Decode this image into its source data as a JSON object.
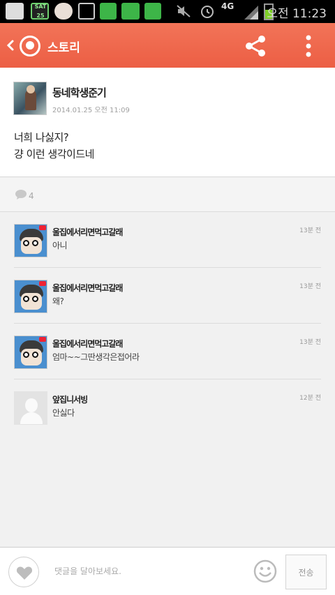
{
  "status_bar": {
    "time": "오전 11:23",
    "network": "4G",
    "calendar_date": "SAT 25",
    "notification_icons": [
      "add-icon",
      "calendar-icon",
      "bear-icon",
      "image-icon",
      "naver-icon",
      "blog-icon",
      "naver-icon",
      "mute-icon",
      "alarm-icon"
    ]
  },
  "app_bar": {
    "title": "스토리",
    "accent_color": "#ef6a50"
  },
  "post": {
    "author": "동네학생준기",
    "date": "2014.01.25 오전 11:09",
    "body_lines": [
      "너희 나싫지?",
      "걍 이런 생각이드네"
    ]
  },
  "comment_count": "4",
  "comments": [
    {
      "name": "울집에서리면먹고갈래",
      "text": "아니",
      "time": "13분 전",
      "avatar": "cartoon"
    },
    {
      "name": "울집에서리면먹고갈래",
      "text": "왜?",
      "time": "13분 전",
      "avatar": "cartoon"
    },
    {
      "name": "울집에서리면먹고갈래",
      "text": "엄마~~그딴생각은접어라",
      "time": "13분 전",
      "avatar": "cartoon"
    },
    {
      "name": "앞집니서빙",
      "text": "안싫다",
      "time": "12분 전",
      "avatar": "default"
    }
  ],
  "input_bar": {
    "placeholder": "댓글을 달아보세요.",
    "send_label": "전송"
  }
}
